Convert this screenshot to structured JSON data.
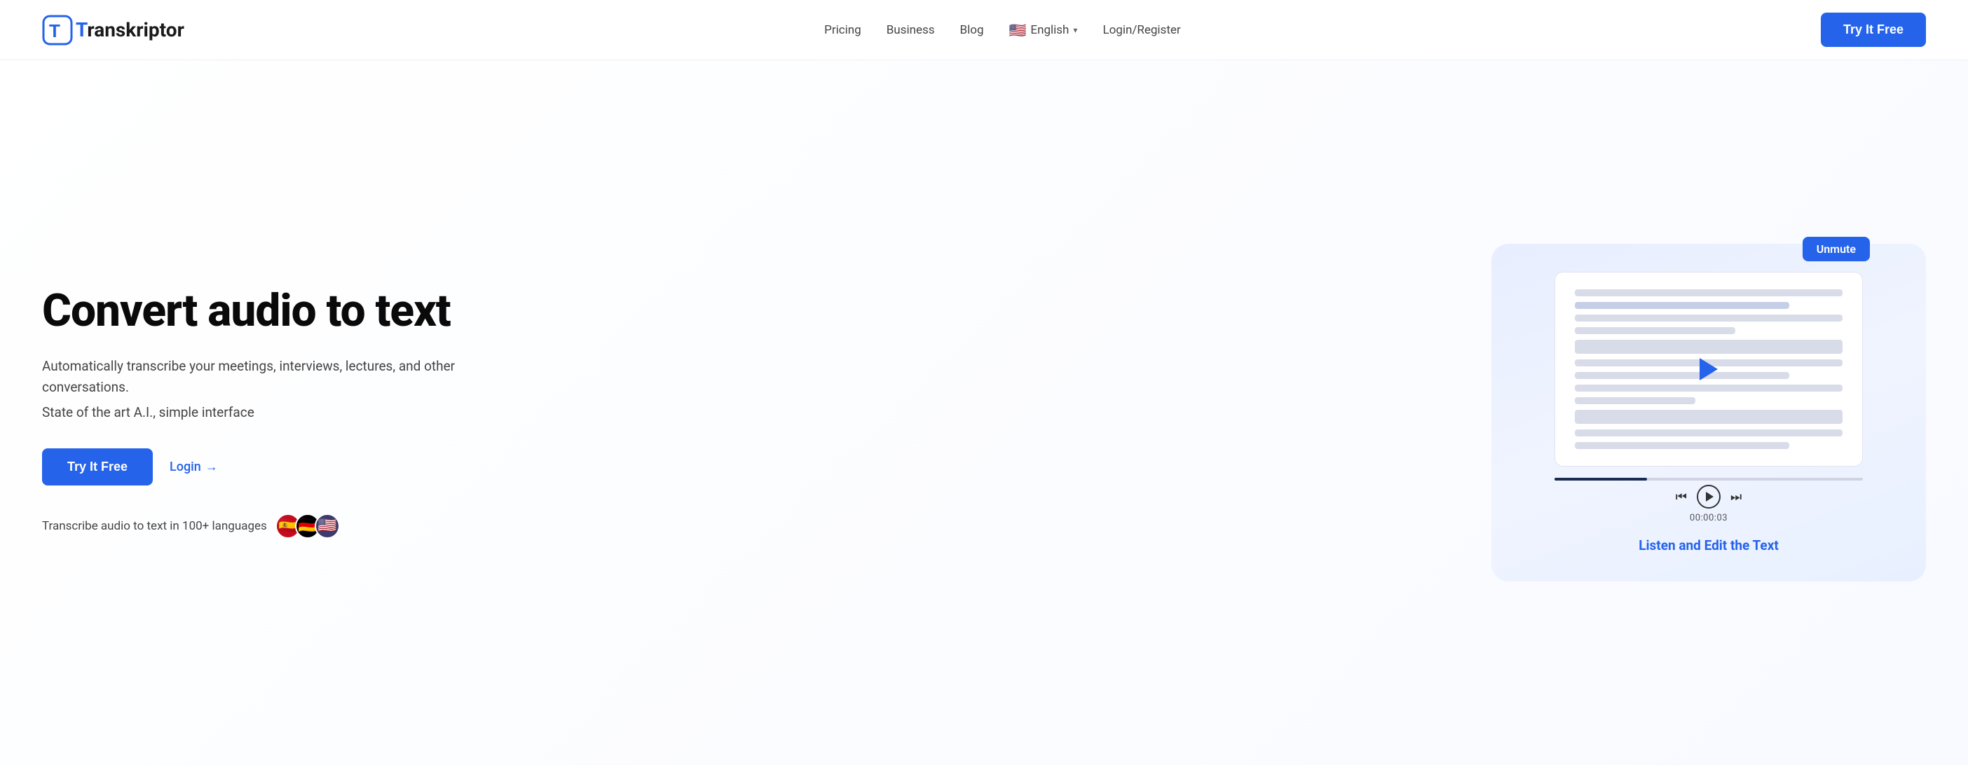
{
  "header": {
    "logo_text": "Transkriptor",
    "nav": {
      "pricing": "Pricing",
      "business": "Business",
      "blog": "Blog",
      "language": "English",
      "login_register": "Login/Register",
      "try_it_free": "Try It Free"
    }
  },
  "hero": {
    "title": "Convert audio to text",
    "subtitle": "Automatically transcribe your meetings, interviews, lectures, and other conversations.",
    "tagline": "State of the art A.I., simple interface",
    "cta_primary": "Try It Free",
    "cta_secondary": "Login",
    "cta_secondary_arrow": "→",
    "languages_text": "Transcribe audio to text in 100+ languages",
    "illustration": {
      "unmute_label": "Unmute",
      "timestamp": "00:00:03",
      "listen_edit_text": "Listen and Edit the Text"
    }
  }
}
